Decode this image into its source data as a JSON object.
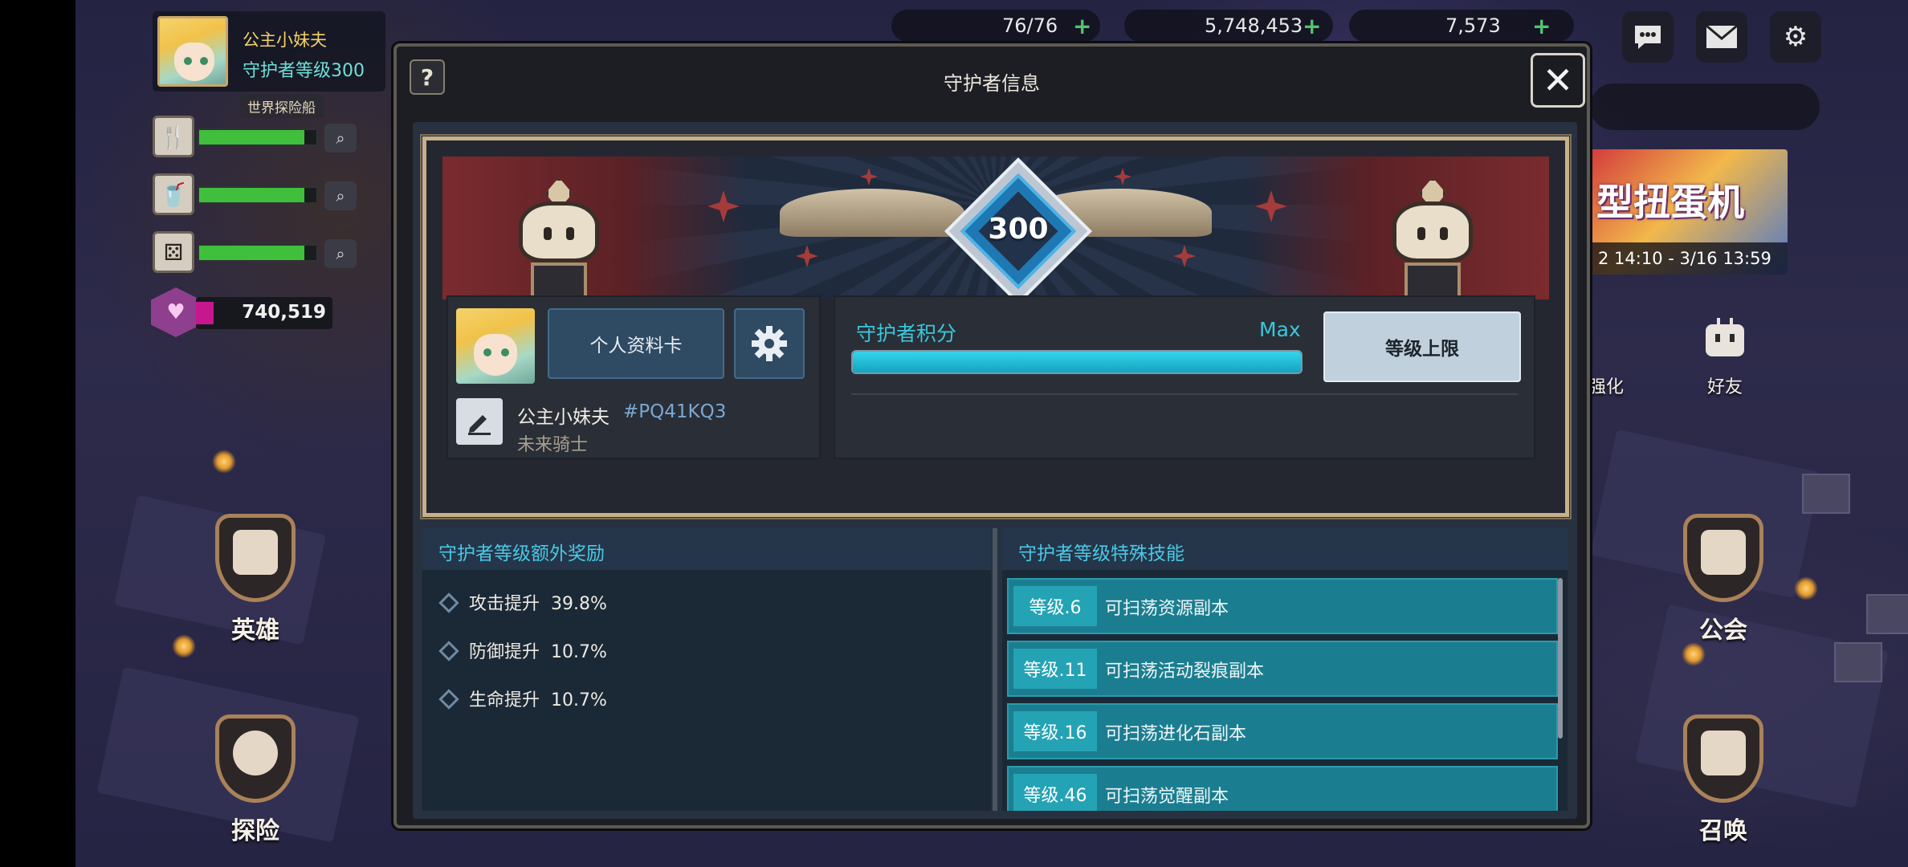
{
  "player": {
    "name": "公主小妹夫",
    "level_text": "守护者等级300",
    "world_ship": "世界探险船",
    "gems": "740,519"
  },
  "stats": [
    {
      "icon": "fork-knife-icon",
      "fill": 0.9
    },
    {
      "icon": "cup-icon",
      "fill": 0.9
    },
    {
      "icon": "dice-icon",
      "fill": 0.9
    }
  ],
  "top_resources": {
    "stamina": "76/76",
    "gold": "5,748,453",
    "crystal": "7,573"
  },
  "left_menu": {
    "hero": "英雄",
    "explore": "探险"
  },
  "right_menu": {
    "enhance": "强化",
    "friend": "好友",
    "guild": "公会",
    "summon": "召唤"
  },
  "event_banner": {
    "title": "型扭蛋机",
    "date": "2 14:10 - 3/16 13:59"
  },
  "modal": {
    "help": "?",
    "title": "守护者信息",
    "close": "✕",
    "level_number": "300",
    "profile": {
      "card_button": "个人资料卡",
      "name": "公主小妹夫",
      "tag": "#PQ41KQ3",
      "title": "未来骑士"
    },
    "score": {
      "label": "守护者积分",
      "max": "Max",
      "progress": 1.0,
      "level_cap_button": "等级上限"
    },
    "rewards": {
      "header": "守护者等级额外奖励",
      "items": [
        {
          "name": "攻击提升",
          "value": "39.8%"
        },
        {
          "name": "防御提升",
          "value": "10.7%"
        },
        {
          "name": "生命提升",
          "value": "10.7%"
        }
      ]
    },
    "skills": {
      "header": "守护者等级特殊技能",
      "items": [
        {
          "level": "等级.6",
          "text": "可扫荡资源副本"
        },
        {
          "level": "等级.11",
          "text": "可扫荡活动裂痕副本"
        },
        {
          "level": "等级.16",
          "text": "可扫荡进化石副本"
        },
        {
          "level": "等级.46",
          "text": "可扫荡觉醒副本"
        }
      ]
    }
  }
}
